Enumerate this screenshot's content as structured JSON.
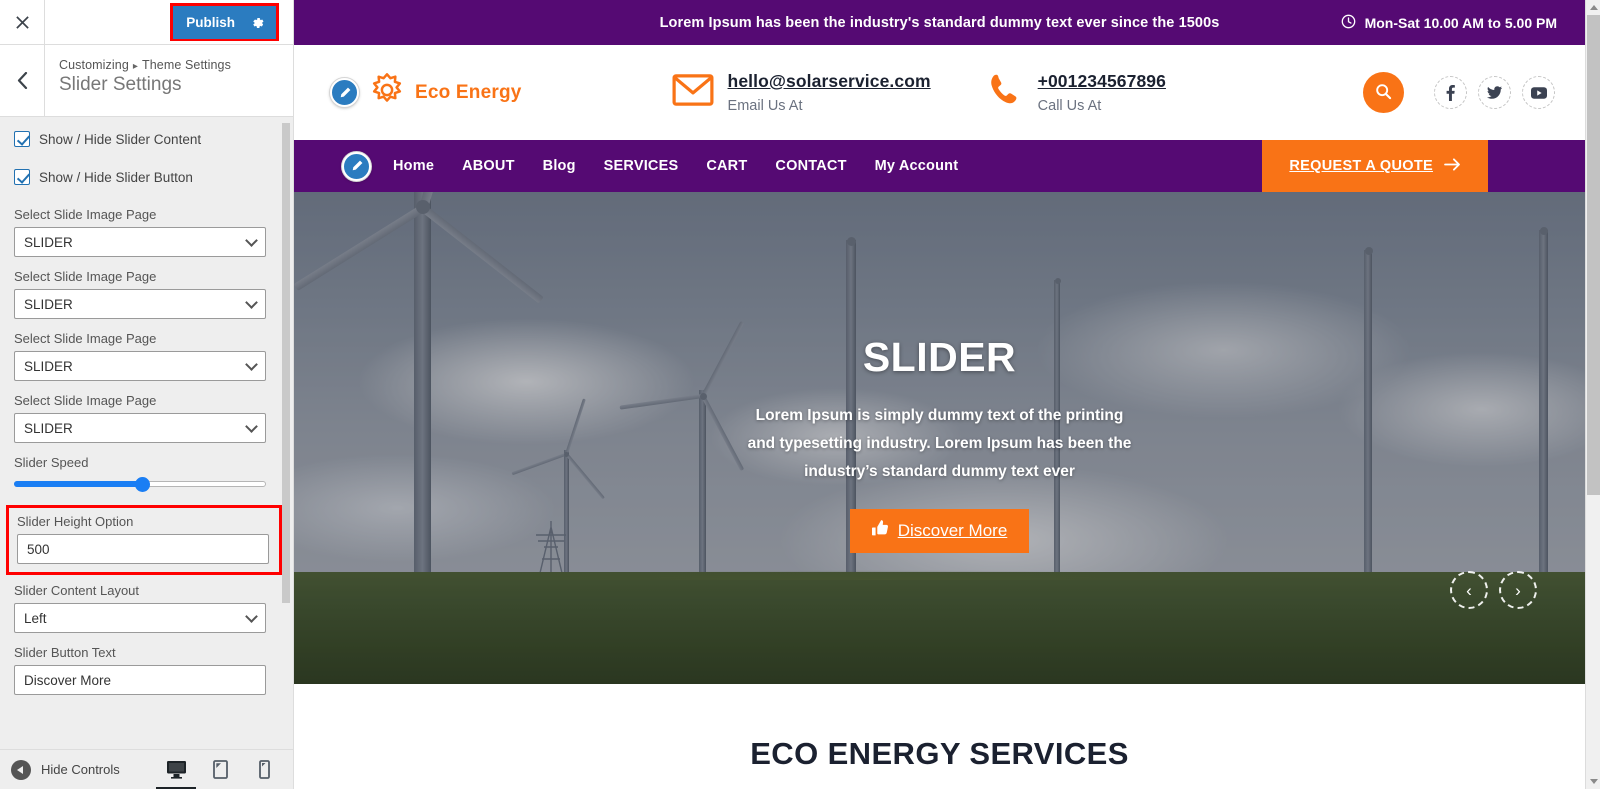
{
  "customizer": {
    "close_icon": "close-icon",
    "publish_label": "Publish",
    "gear_icon": "gear-icon",
    "back_icon": "chevron-left-icon",
    "breadcrumb_root": "Customizing",
    "breadcrumb_sep": "▸",
    "breadcrumb_parent": "Theme Settings",
    "panel_title": "Slider Settings",
    "checkboxes": [
      {
        "label": "Show / Hide Slider Content",
        "checked": true
      },
      {
        "label": "Show / Hide Slider Button",
        "checked": true
      }
    ],
    "slide_selects": [
      {
        "label": "Select Slide Image Page",
        "value": "SLIDER"
      },
      {
        "label": "Select Slide Image Page",
        "value": "SLIDER"
      },
      {
        "label": "Select Slide Image Page",
        "value": "SLIDER"
      },
      {
        "label": "Select Slide Image Page",
        "value": "SLIDER"
      }
    ],
    "slider_speed": {
      "label": "Slider Speed",
      "percent": 51
    },
    "slider_height": {
      "label": "Slider Height Option",
      "value": "500"
    },
    "content_layout": {
      "label": "Slider Content Layout",
      "value": "Left"
    },
    "button_text": {
      "label": "Slider Button Text",
      "value": "Discover More"
    },
    "footer": {
      "hide_controls_label": "Hide Controls",
      "devices": [
        {
          "name": "desktop",
          "active": true
        },
        {
          "name": "tablet",
          "active": false
        },
        {
          "name": "mobile",
          "active": false
        }
      ]
    },
    "accent_blue": "#2b7cc0",
    "highlight_red": "#ff0000"
  },
  "site": {
    "topbar": {
      "message": "Lorem Ipsum has been the industry's standard dummy text ever since the 1500s",
      "clock_icon": "clock-icon",
      "hours": "Mon-Sat 10.00 AM to 5.00 PM",
      "bg_color": "#550A73"
    },
    "header": {
      "brand_name": "Eco Energy",
      "logo_icon": "sun-icon",
      "edit_icon": "edit-pencil-icon",
      "email": {
        "icon": "envelope-icon",
        "value": "hello@solarservice.com",
        "caption": "Email Us At"
      },
      "phone": {
        "icon": "phone-icon",
        "value": "+001234567896",
        "caption": "Call Us At"
      },
      "search_icon": "search-icon",
      "socials": [
        {
          "name": "facebook",
          "glyph": "f"
        },
        {
          "name": "twitter",
          "glyph": "t"
        },
        {
          "name": "youtube",
          "glyph": "y"
        }
      ],
      "accent_color": "#F97316"
    },
    "nav": {
      "edit_icon": "edit-pencil-icon",
      "items": [
        {
          "label": "Home"
        },
        {
          "label": "ABOUT"
        },
        {
          "label": "Blog"
        },
        {
          "label": "SERVICES"
        },
        {
          "label": "CART"
        },
        {
          "label": "CONTACT"
        },
        {
          "label": "My Account"
        }
      ],
      "quote_button": {
        "label": "REQUEST A QUOTE",
        "icon": "arrow-right-icon"
      }
    },
    "slider": {
      "title": "SLIDER",
      "description": "Lorem Ipsum is simply dummy text of the printing and typesetting industry. Lorem Ipsum has been the industry’s standard dummy text ever",
      "button": {
        "label": "Discover More",
        "icon": "thumbs-up-icon"
      },
      "prev_icon": "chevron-left-icon",
      "next_icon": "chevron-right-icon",
      "prev_glyph": "‹",
      "next_glyph": "›"
    },
    "section": {
      "title": "ECO ENERGY SERVICES"
    }
  }
}
